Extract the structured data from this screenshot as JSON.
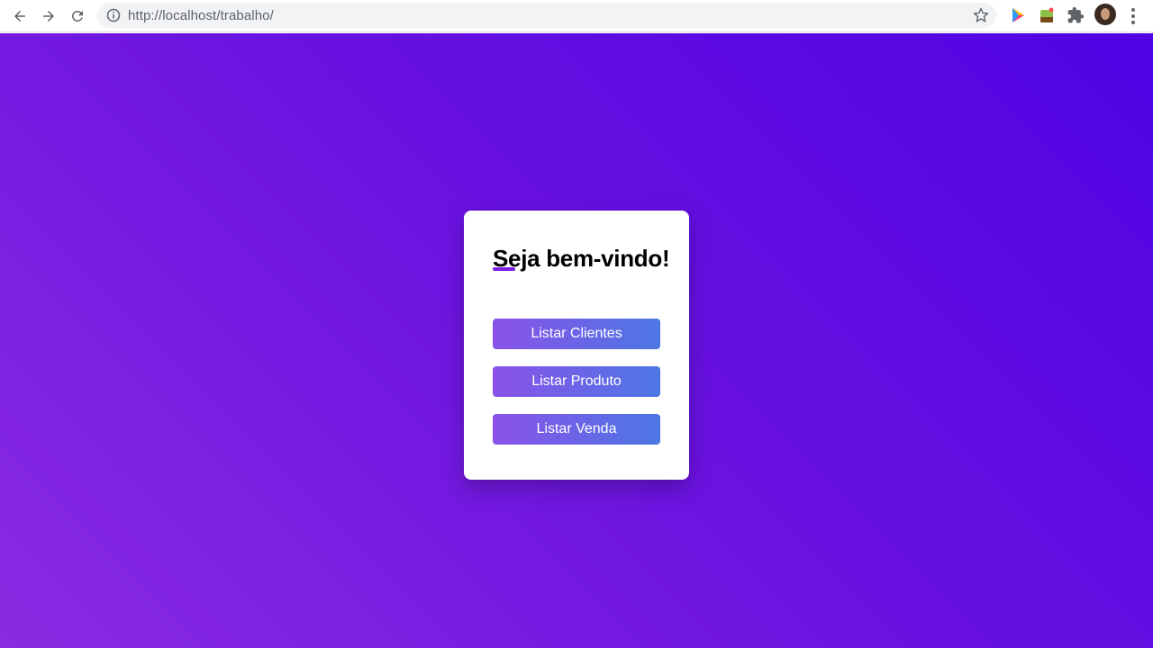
{
  "browser": {
    "url": "http://localhost/trabalho/",
    "icons": {
      "back": "back-arrow-icon",
      "forward": "forward-arrow-icon",
      "reload": "reload-icon",
      "site_info": "info-icon",
      "bookmark": "star-icon",
      "extension_play": "play-icon",
      "extension_plant": "plant-icon",
      "extensions": "puzzle-icon",
      "profile": "avatar",
      "menu": "kebab-menu-icon"
    }
  },
  "page": {
    "background_colors": [
      "#8a2be2",
      "#4f03e3"
    ],
    "card": {
      "title": "Seja bem-vindo!",
      "accent_color": "#7b1fe0",
      "buttons": [
        {
          "label": "Listar Clientes"
        },
        {
          "label": "Listar Produto"
        },
        {
          "label": "Listar Venda"
        }
      ],
      "button_gradient": [
        "#8a52e8",
        "#4c77e4"
      ]
    }
  }
}
